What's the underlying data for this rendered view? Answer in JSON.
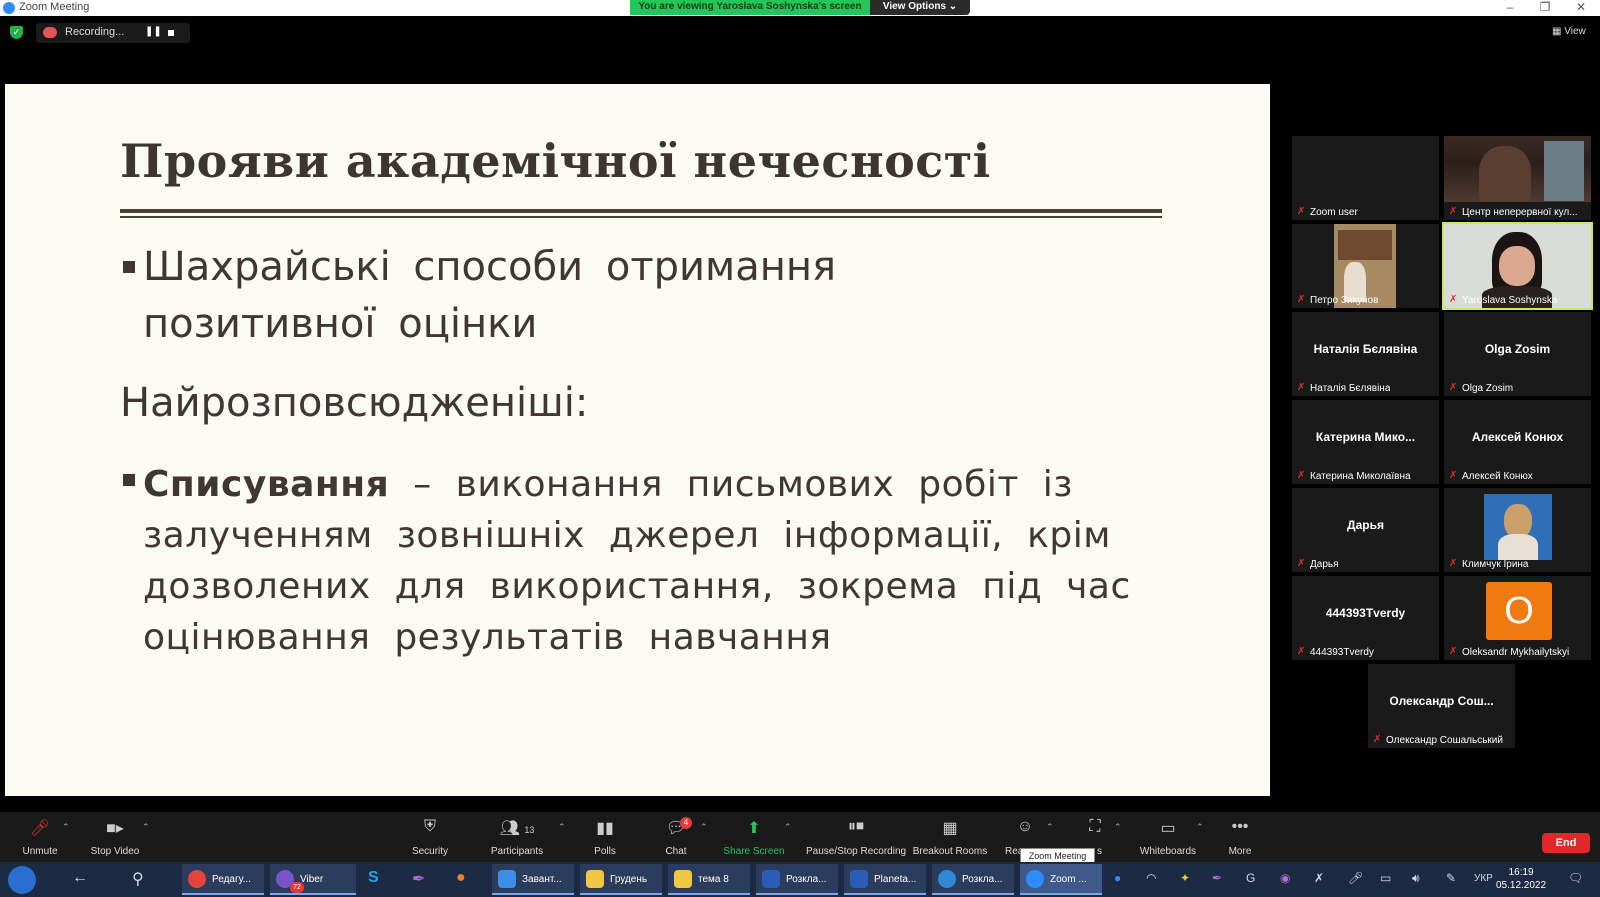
{
  "window": {
    "title": "Zoom Meeting",
    "viewing_banner": "You are viewing Yaroslava Soshynska's screen",
    "view_options": "View Options ⌄",
    "view_label": "View"
  },
  "recording": {
    "label": "Recording..."
  },
  "slide": {
    "title": "Прояви академічної нечесності",
    "bullet1_line1": "Шахрайські способи отримання",
    "bullet1_line2": "позитивної оцінки",
    "subheading": "Найрозповсюдженіші:",
    "bullet2_bold": "Списування",
    "bullet2_rest": " – виконання письмових робіт із залученням зовнішніх джерел інформації, крім дозволених для використання, зокрема під час оцінювання результатів навчання"
  },
  "participants": [
    {
      "name": "Zoom user",
      "display": ""
    },
    {
      "name": "Центр неперервної кул...",
      "display": ""
    },
    {
      "name": "Петро Зикунов",
      "display": ""
    },
    {
      "name": "Yaroslava Soshynska",
      "display": ""
    },
    {
      "name": "Наталія Бєлявіна",
      "display": "Наталія Бєлявіна"
    },
    {
      "name": "Olga Zosim",
      "display": "Olga Zosim"
    },
    {
      "name": "Катерина Миколаївна",
      "display": "Катерина Мико..."
    },
    {
      "name": "Алексей Конюх",
      "display": "Алексей Конюх"
    },
    {
      "name": "Дарья",
      "display": "Дарья"
    },
    {
      "name": "Климчук Ірина",
      "display": ""
    },
    {
      "name": "444393Tverdy",
      "display": "444393Tverdy"
    },
    {
      "name": "Oleksandr Mykhailytskyi",
      "display": "",
      "avatar_letter": "O"
    },
    {
      "name": "Олександр Сошальський",
      "display": "Олександр Сош..."
    }
  ],
  "toolbar": {
    "unmute": "Unmute",
    "stop_video": "Stop Video",
    "security": "Security",
    "participants": "Participants",
    "participants_count": "13",
    "polls": "Polls",
    "chat": "Chat",
    "chat_badge": "4",
    "share_screen": "Share Screen",
    "pause_stop_recording": "Pause/Stop Recording",
    "breakout_rooms": "Breakout Rooms",
    "reactions": "Rea",
    "apps": "s",
    "whiteboards": "Whiteboards",
    "more": "More",
    "end": "End",
    "tooltip": "Zoom Meeting"
  },
  "taskbar": {
    "tasks": [
      "Редагу...",
      "Viber",
      "Завант...",
      "Грудень",
      "тема 8",
      "Розкла...",
      "Planeta...",
      "Розкла...",
      "Zoom ..."
    ],
    "viber_badge": "72",
    "language": "УКР",
    "time": "16:19",
    "date": "05.12.2022"
  },
  "colors": {
    "accent_green": "#23c65a",
    "end_red": "#e02828",
    "active_speaker": "#c8e85b",
    "slide_bg": "#fbfaf3"
  }
}
